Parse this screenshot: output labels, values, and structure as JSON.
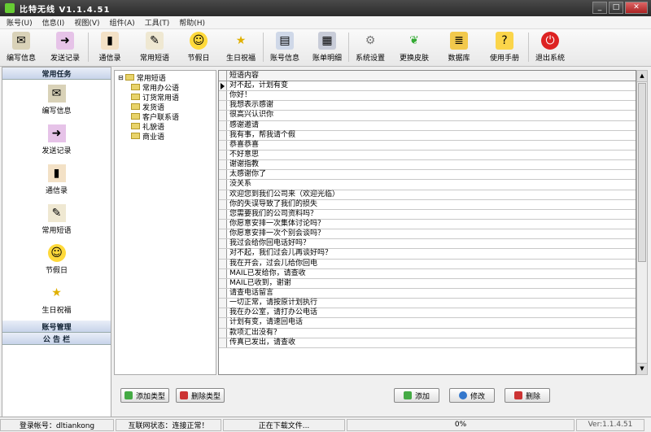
{
  "window": {
    "title": "比特无线  V1.1.4.51"
  },
  "menu": [
    "账号(U)",
    "信息(I)",
    "视图(V)",
    "组件(A)",
    "工具(T)",
    "帮助(H)"
  ],
  "toolbar": {
    "write_msg": "编写信息",
    "send_log": "发送记录",
    "contacts": "通信录",
    "common_sms": "常用短语",
    "holiday": "节假日",
    "birthday": "生日祝福",
    "account_info": "账号信息",
    "bill_detail": "账单明细",
    "settings": "系统设置",
    "skin": "更换皮肤",
    "database": "数据库",
    "manual": "使用手册",
    "exit": "退出系统"
  },
  "sidebar": {
    "group1": "常用任务",
    "items": [
      "编写信息",
      "发送记录",
      "通信录",
      "常用短语",
      "节假日",
      "生日祝福"
    ],
    "group2": "账号管理",
    "group3": "公 告 栏"
  },
  "tree": {
    "root": "常用短语",
    "children": [
      "常用办公语",
      "订货常用语",
      "发货语",
      "客户联系语",
      "礼貌语",
      "商业语"
    ]
  },
  "grid": {
    "header": "短语内容",
    "rows": [
      "对不起，计划有变",
      "你好！",
      "我想表示感谢",
      "很高兴认识你",
      "感谢邀请",
      "我有事，帮我请个假",
      "恭喜恭喜",
      "不好意思",
      "谢谢指教",
      "太感谢你了",
      "没关系",
      "欢迎您到我们公司来（欢迎光临）",
      "你的失误导致了我们的损失",
      "您需要我们的公司资料吗？",
      "你愿意安排一次集体讨论吗？",
      "你愿意安排一次个别会谈吗？",
      "我过会给你回电话好吗？",
      "对不起，我们过会儿再谈好吗？",
      "我在开会，过会儿给你回电",
      "MAIL已发给你，请查收",
      "MAIL已收到，谢谢",
      "请查电话留言",
      "一切正常，请按原计划执行",
      "我在办公室，请打办公电话",
      "计划有变，请速回电话",
      "款项汇出没有？",
      "传真已发出，请查收"
    ]
  },
  "buttons": {
    "add_type": "添加类型",
    "del_type": "删除类型",
    "add": "添加",
    "edit": "修改",
    "delete": "删除"
  },
  "status": {
    "account": "登录帐号：dltiankong",
    "network": "互联网状态：连接正常！",
    "download": "正在下载文件...",
    "progress": "0%",
    "version": "Ver:1.1.4.51"
  }
}
